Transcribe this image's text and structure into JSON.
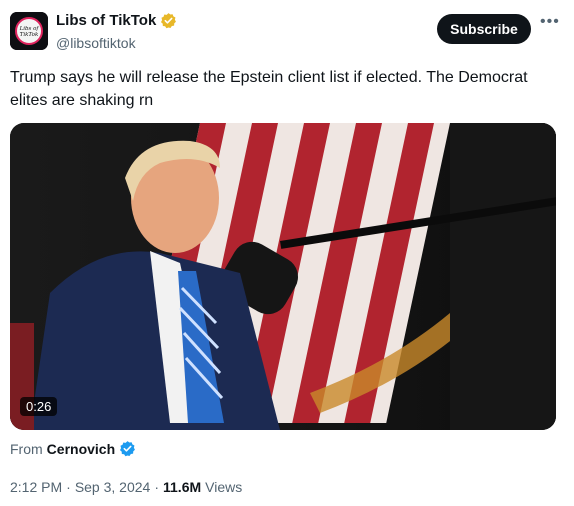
{
  "author": {
    "display_name": "Libs of TikTok",
    "handle": "@libsoftiktok",
    "avatar_text": "Libs of TikTok",
    "badge_color": "#e8b829"
  },
  "actions": {
    "subscribe_label": "Subscribe",
    "more_icon": "more-horizontal-icon"
  },
  "tweet": {
    "text": "Trump says he will release the Epstein client list if elected. The Democrat elites are shaking rn"
  },
  "media": {
    "duration": "0:26"
  },
  "source": {
    "prefix": "From",
    "name": "Cernovich",
    "badge_color": "#1d9bf0"
  },
  "meta": {
    "time": "2:12 PM",
    "separator": "·",
    "date": "Sep 3, 2024",
    "views_count": "11.6M",
    "views_label": "Views"
  }
}
